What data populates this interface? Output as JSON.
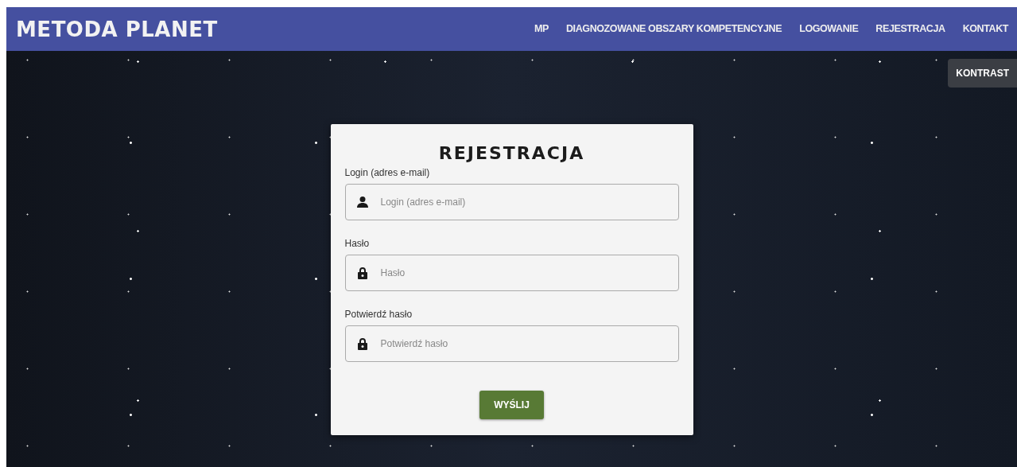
{
  "brand": "METODA PLANET",
  "nav": [
    {
      "label": "MP"
    },
    {
      "label": "DIAGNOZOWANE OBSZARY KOMPETENCYJNE"
    },
    {
      "label": "LOGOWANIE"
    },
    {
      "label": "REJESTRACJA"
    },
    {
      "label": "KONTAKT"
    }
  ],
  "contrast_button": "KONTRAST",
  "form": {
    "title": "REJESTRACJA",
    "fields": [
      {
        "label": "Login (adres e-mail)",
        "kind": "user",
        "placeholder": "Login (adres e-mail)"
      },
      {
        "label": "Hasło",
        "kind": "lock",
        "placeholder": "Hasło"
      },
      {
        "label": "Potwierdź hasło",
        "kind": "lock",
        "placeholder": "Potwierdź hasło"
      }
    ],
    "submit": "WYŚLIJ"
  }
}
